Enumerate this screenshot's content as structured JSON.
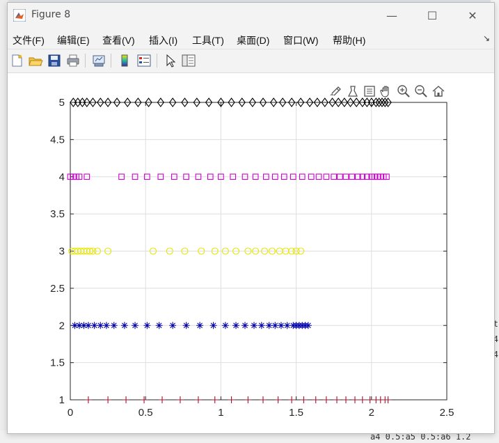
{
  "window": {
    "title": "Figure 8",
    "controls": {
      "minimize": "—",
      "maximize": "☐",
      "close": "✕"
    }
  },
  "menu": [
    "文件(F)",
    "编辑(E)",
    "查看(V)",
    "插入(I)",
    "工具(T)",
    "桌面(D)",
    "窗口(W)",
    "帮助(H)"
  ],
  "menu_overflow_icon": "arrow-icon",
  "toolbar": [
    "new-figure-icon",
    "open-file-icon",
    "save-icon",
    "print-icon",
    "link-plot-icon",
    "insert-colorbar-icon",
    "insert-legend-icon",
    "edit-plot-icon",
    "property-inspector-icon"
  ],
  "axes_toolbar": [
    "brush-icon",
    "data-tips-icon",
    "restore-view-icon",
    "pan-icon",
    "zoom-in-icon",
    "zoom-out-icon",
    "home-icon"
  ],
  "background": {
    "right_snippets": [
      "t",
      "4",
      "4"
    ],
    "bottom_snippet": "a4 0.5:a5 0.5:a6 1.2"
  },
  "chart_data": {
    "type": "scatter",
    "title": "",
    "xlabel": "",
    "ylabel": "",
    "xlim": [
      0,
      2.5
    ],
    "ylim": [
      1,
      5
    ],
    "xticks": [
      "0",
      "0.5",
      "1",
      "1.5",
      "2",
      "2.5"
    ],
    "yticks": [
      "1",
      "1.5",
      "2",
      "2.5",
      "3",
      "3.5",
      "4",
      "4.5",
      "5"
    ],
    "grid": true,
    "series": [
      {
        "marker": "plus",
        "color": "#a2142f",
        "y": 1,
        "x": [
          0.12,
          0.25,
          0.37,
          0.49,
          0.61,
          0.73,
          0.85,
          0.96,
          1.07,
          1.18,
          1.28,
          1.38,
          1.47,
          1.55,
          1.63,
          1.7,
          1.77,
          1.83,
          1.89,
          1.94,
          1.99,
          2.03,
          2.06,
          2.09,
          2.11
        ]
      },
      {
        "marker": "star",
        "color": "#0000aa",
        "y": 2,
        "x": [
          0.03,
          0.06,
          0.09,
          0.12,
          0.16,
          0.2,
          0.24,
          0.29,
          0.36,
          0.43,
          0.51,
          0.59,
          0.68,
          0.77,
          0.86,
          0.95,
          1.03,
          1.1,
          1.16,
          1.22,
          1.27,
          1.32,
          1.36,
          1.4,
          1.44,
          1.48,
          1.5,
          1.52,
          1.54,
          1.56,
          1.58
        ]
      },
      {
        "marker": "circle",
        "color": "#e6e600",
        "y": 3,
        "x": [
          0.01,
          0.03,
          0.05,
          0.07,
          0.09,
          0.11,
          0.13,
          0.15,
          0.18,
          0.25,
          0.55,
          0.66,
          0.76,
          0.87,
          0.96,
          1.03,
          1.1,
          1.18,
          1.23,
          1.29,
          1.34,
          1.39,
          1.43,
          1.47,
          1.5,
          1.53
        ]
      },
      {
        "marker": "square",
        "color": "#cc00cc",
        "y": 4,
        "x": [
          0.0,
          0.02,
          0.04,
          0.06,
          0.11,
          0.34,
          0.43,
          0.51,
          0.6,
          0.69,
          0.77,
          0.85,
          0.93,
          1.0,
          1.08,
          1.16,
          1.23,
          1.3,
          1.36,
          1.42,
          1.48,
          1.54,
          1.6,
          1.65,
          1.7,
          1.75,
          1.79,
          1.83,
          1.87,
          1.91,
          1.94,
          1.97,
          2.0,
          2.02,
          2.04,
          2.06,
          2.08,
          2.1
        ]
      },
      {
        "marker": "diamond",
        "color": "#000000",
        "y": 5,
        "x": [
          0.02,
          0.05,
          0.08,
          0.11,
          0.15,
          0.2,
          0.25,
          0.31,
          0.38,
          0.45,
          0.52,
          0.6,
          0.68,
          0.76,
          0.84,
          0.92,
          1.0,
          1.07,
          1.14,
          1.21,
          1.28,
          1.35,
          1.41,
          1.47,
          1.53,
          1.59,
          1.64,
          1.69,
          1.74,
          1.78,
          1.82,
          1.86,
          1.9,
          1.94,
          1.97,
          2.0,
          2.03,
          2.05,
          2.07,
          2.09,
          2.11
        ]
      }
    ]
  }
}
